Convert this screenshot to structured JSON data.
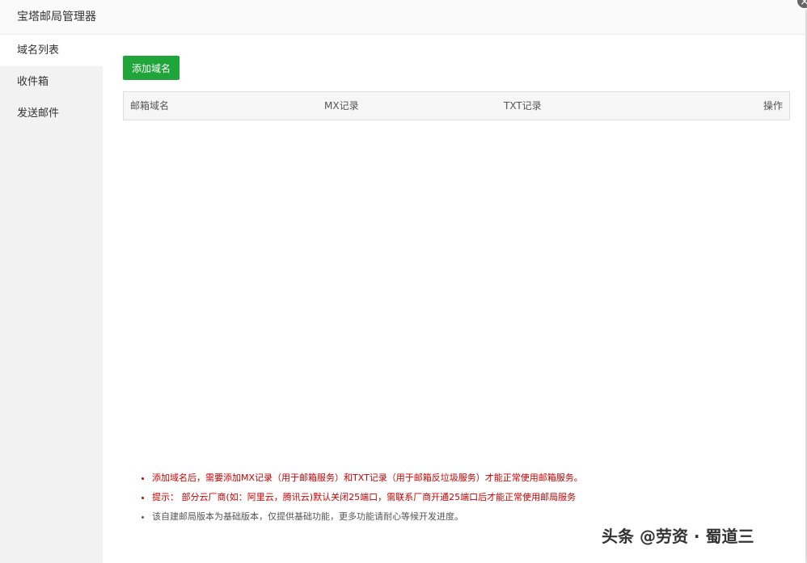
{
  "dialog": {
    "title": "宝塔邮局管理器",
    "close_icon": "×"
  },
  "sidebar": {
    "items": [
      {
        "label": "域名列表",
        "active": true
      },
      {
        "label": "收件箱",
        "active": false
      },
      {
        "label": "发送邮件",
        "active": false
      }
    ]
  },
  "toolbar": {
    "add_domain_label": "添加域名"
  },
  "table": {
    "headers": {
      "domain": "邮箱域名",
      "mx": "MX记录",
      "txt": "TXT记录",
      "actions": "操作"
    }
  },
  "notes": [
    {
      "text": "添加域名后，需要添加MX记录（用于邮箱服务）和TXT记录（用于邮箱反垃圾服务）才能正常使用邮箱服务。",
      "style": "red"
    },
    {
      "text": "提示： 部分云厂商(如：阿里云，腾讯云)默认关闭25端口，需联系厂商开通25端口后才能正常使用邮局服务",
      "style": "red"
    },
    {
      "text": "该自建邮局版本为基础版本，仅提供基础功能，更多功能请耐心等候开发进度。",
      "style": "gray"
    }
  ],
  "watermark": {
    "text": "头条 @劳资 · 蜀道三"
  },
  "colors": {
    "accent": "#20a53a",
    "note_red": "#cc0000",
    "sidebar_bg": "#f2f2f2"
  }
}
